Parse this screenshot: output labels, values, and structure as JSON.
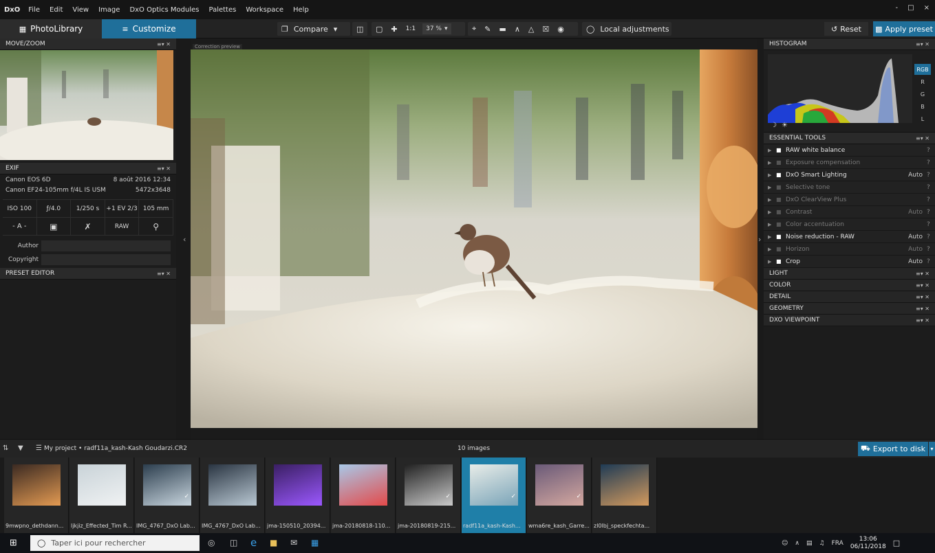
{
  "menubar": {
    "logo": "DxO",
    "items": [
      "File",
      "Edit",
      "View",
      "Image",
      "DxO Optics Modules",
      "Palettes",
      "Workspace",
      "Help"
    ],
    "window_controls": [
      "-",
      "□",
      "×"
    ]
  },
  "toolbar": {
    "tab_library": "PhotoLibrary",
    "tab_customize": "Customize",
    "compare_label": "Compare",
    "zoom_1to1": "1:1",
    "zoom_level": "37 %",
    "local_adjustments": "Local adjustments",
    "reset_label": "Reset",
    "apply_preset_label": "Apply preset"
  },
  "move_zoom": {
    "title": "MOVE/ZOOM"
  },
  "exif": {
    "title": "EXIF",
    "camera": "Canon EOS 6D",
    "date": "8 août 2016 12:34",
    "lens": "Canon EF24-105mm f/4L IS USM",
    "resolution": "5472x3648",
    "iso": "ISO 100",
    "aperture": "ƒ/4.0",
    "shutter": "1/250 s",
    "ev": "+1 EV 2/3",
    "focal": "105 mm",
    "mode": "- A -",
    "raw": "RAW",
    "author_label": "Author",
    "copyright_label": "Copyright"
  },
  "preset_editor": {
    "title": "PRESET EDITOR"
  },
  "viewer": {
    "label": "Correction preview"
  },
  "histogram": {
    "title": "HISTOGRAM",
    "channels": [
      "RGB",
      "R",
      "G",
      "B",
      "L"
    ],
    "active_channel": "RGB"
  },
  "essential_tools": {
    "title": "ESSENTIAL TOOLS",
    "items": [
      {
        "name": "RAW white balance",
        "status": "",
        "enabled": true
      },
      {
        "name": "Exposure compensation",
        "status": "",
        "enabled": false
      },
      {
        "name": "DxO Smart Lighting",
        "status": "Auto",
        "enabled": true
      },
      {
        "name": "Selective tone",
        "status": "",
        "enabled": false
      },
      {
        "name": "DxO ClearView Plus",
        "status": "",
        "enabled": false
      },
      {
        "name": "Contrast",
        "status": "Auto",
        "enabled": false
      },
      {
        "name": "Color accentuation",
        "status": "",
        "enabled": false
      },
      {
        "name": "Noise reduction - RAW",
        "status": "Auto",
        "enabled": true
      },
      {
        "name": "Horizon",
        "status": "Auto",
        "enabled": false
      },
      {
        "name": "Crop",
        "status": "Auto",
        "enabled": true
      }
    ]
  },
  "palette_groups": [
    "LIGHT",
    "COLOR",
    "DETAIL",
    "GEOMETRY",
    "DXO VIEWPOINT"
  ],
  "filmbar": {
    "breadcrumb": "My project • radf11a_kash-Kash Goudarzi.CR2",
    "image_count": "10 images",
    "export_label": "Export to disk"
  },
  "filmstrip": [
    {
      "caption": "9mwpno_dethdann...",
      "selected": false,
      "check": false
    },
    {
      "caption": "ljkjiz_Effected_Tim R...",
      "selected": false,
      "check": false
    },
    {
      "caption": "IMG_4767_DxO Lab...",
      "selected": false,
      "check": true
    },
    {
      "caption": "IMG_4767_DxO Lab...",
      "selected": false,
      "check": false
    },
    {
      "caption": "jma-150510_20394...",
      "selected": false,
      "check": false
    },
    {
      "caption": "jma-20180818-110...",
      "selected": false,
      "check": false
    },
    {
      "caption": "jma-20180819-215...",
      "selected": false,
      "check": true
    },
    {
      "caption": "radf11a_kash-Kash...",
      "selected": true,
      "check": true
    },
    {
      "caption": "wma6re_kash_Garre...",
      "selected": false,
      "check": true
    },
    {
      "caption": "zl0lbj_speckfechta...",
      "selected": false,
      "check": false
    }
  ],
  "taskbar": {
    "search_placeholder": "Taper ici pour rechercher",
    "lang": "FRA",
    "time": "13:06",
    "date": "06/11/2018"
  },
  "colors": {
    "accent": "#1f6f9a",
    "panel": "#1c1c1c"
  }
}
